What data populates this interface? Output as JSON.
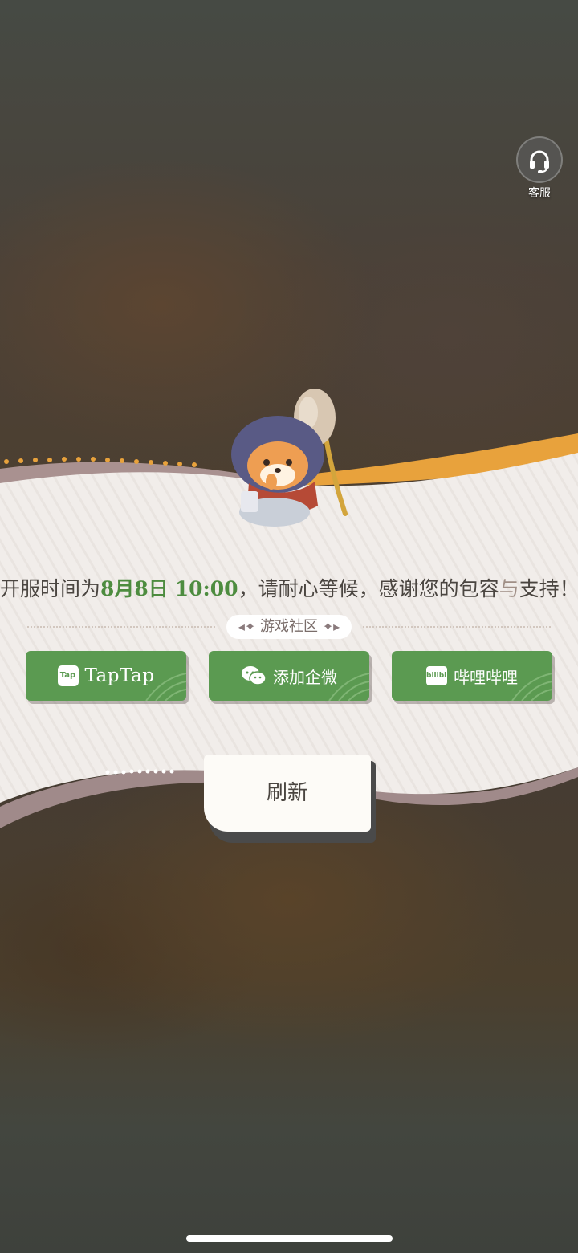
{
  "customer_service": {
    "label": "客服",
    "icon": "headset-icon"
  },
  "notice": {
    "prefix": "开服时间为",
    "date": "8月8日",
    "time": "10:00",
    "suffix_a": "，请耐心等候，感谢您的包容",
    "suffix_connector": "与",
    "suffix_b": "支持！"
  },
  "community": {
    "label": "游戏社区"
  },
  "buttons": {
    "taptap": {
      "icon_text": "Tap",
      "label": "TapTap"
    },
    "wechat": {
      "label": "添加企微"
    },
    "bilibili": {
      "icon_text": "bilibili",
      "label": "哔哩哔哩"
    }
  },
  "refresh": {
    "label": "刷新"
  },
  "colors": {
    "accent_green": "#5b9a51",
    "highlight_green": "#4d8c3f",
    "panel_bg": "#f1edea",
    "orange_ribbon": "#e8a23c"
  }
}
